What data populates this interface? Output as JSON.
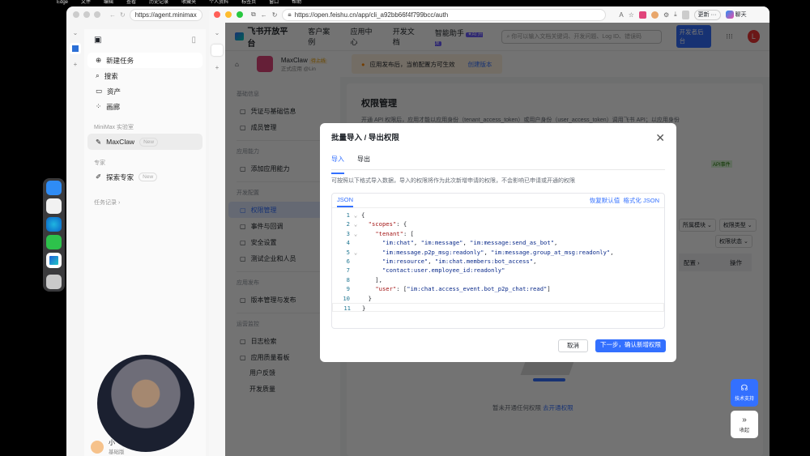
{
  "menubar": {
    "items": [
      "Edge",
      "文件",
      "编辑",
      "查看",
      "历史记录",
      "收藏夹",
      "个人资料",
      "标签页",
      "窗口",
      "帮助"
    ]
  },
  "left_window": {
    "url": "https://agent.minimax",
    "nav": [
      {
        "icon": "plus-circle-icon",
        "label": "新建任务"
      },
      {
        "icon": "search-icon",
        "label": "搜索"
      },
      {
        "icon": "folder-icon",
        "label": "资产"
      },
      {
        "icon": "grid-icon",
        "label": "画廊"
      }
    ],
    "section_lab": "MiniMax 实验室",
    "maxclaw": {
      "label": "MaxClaw",
      "badge": "New"
    },
    "section_expert": "专家",
    "expert": {
      "label": "探索专家",
      "badge": "New"
    },
    "history": "任务记录 ›",
    "user": {
      "name": "小",
      "plan": "基础版"
    }
  },
  "right_window": {
    "url": "https://open.feishu.cn/app/cli_a92bb66f4f799bcc/auth",
    "toolbar": {
      "update": "更新 ···",
      "chat": "聊天"
    }
  },
  "feishu": {
    "brand": "飞书开放平台",
    "nav": [
      "客户案例",
      "应用中心",
      "开发文档",
      "智能助手"
    ],
    "ai_badge": "✦AI 开发",
    "search_placeholder": "你可以输入文档关键词、开发问题、Log ID、错误码",
    "console": "开发者后台",
    "avatar": "L",
    "app": {
      "name": "MaxClaw",
      "status": "待上线",
      "sub": "正式应用 @Lin"
    },
    "notice": "应用发布后，当前配置方可生效",
    "notice_link": "创建版本",
    "sidebar": [
      {
        "section": "基础信息",
        "items": [
          {
            "icon": "id-card-icon",
            "label": "凭证与基础信息"
          },
          {
            "icon": "user-icon",
            "label": "成员管理"
          }
        ]
      },
      {
        "section": "应用能力",
        "items": [
          {
            "icon": "apps-icon",
            "label": "添加应用能力"
          }
        ]
      },
      {
        "section": "开发配置",
        "items": [
          {
            "icon": "lock-icon",
            "label": "权限管理",
            "active": true
          },
          {
            "icon": "event-icon",
            "label": "事件与回调"
          },
          {
            "icon": "shield-icon",
            "label": "安全设置"
          },
          {
            "icon": "test-icon",
            "label": "测试企业和人员"
          }
        ]
      },
      {
        "section": "应用发布",
        "items": [
          {
            "icon": "upload-icon",
            "label": "版本管理与发布"
          }
        ]
      },
      {
        "section": "运营监控",
        "items": [
          {
            "icon": "log-icon",
            "label": "日志检索"
          },
          {
            "icon": "chart-icon",
            "label": "应用质量看板"
          }
        ]
      }
    ],
    "sidebar_sub": [
      "用户反馈",
      "开发质量"
    ],
    "main": {
      "title": "权限管理",
      "desc": "开通 API 权限后，应用才能以应用身份（tenant_access_token）或用户身份（user_access_token）调用飞书 API；以应用身份",
      "filters": [
        "所属模块 ⌄",
        "权限类型 ⌄",
        "权限状态 ⌄"
      ],
      "col_config": "配置 ›",
      "col_action": "操作",
      "empty": "暂未开通任何权限",
      "empty_link": "去开通权限",
      "green_tag": "API事件"
    },
    "float": {
      "support": "技术支持",
      "collapse": "收起"
    }
  },
  "modal": {
    "title": "批量导入 / 导出权限",
    "tabs": [
      "导入",
      "导出"
    ],
    "hint": "可按照以下格式导入数据，导入的权限将作为此次新增申请的权限，不会影响已申请或开通的权限",
    "editor_tab": "JSON",
    "restore": "恢复默认值",
    "format": "格式化 JSON",
    "code": [
      "{",
      "  \"scopes\": {",
      "    \"tenant\": [",
      "      \"im:chat\", \"im:message\", \"im:message:send_as_bot\",",
      "      \"im:message.p2p_msg:readonly\", \"im:message.group_at_msg:readonly\",",
      "      \"im:resource\", \"im:chat.members:bot_access\",",
      "      \"contact:user.employee_id:readonly\"",
      "    ],",
      "    \"user\": [\"im:chat.access_event.bot_p2p_chat:read\"]",
      "  }",
      "}"
    ],
    "cancel": "取消",
    "confirm": "下一步，确认新增权限"
  }
}
